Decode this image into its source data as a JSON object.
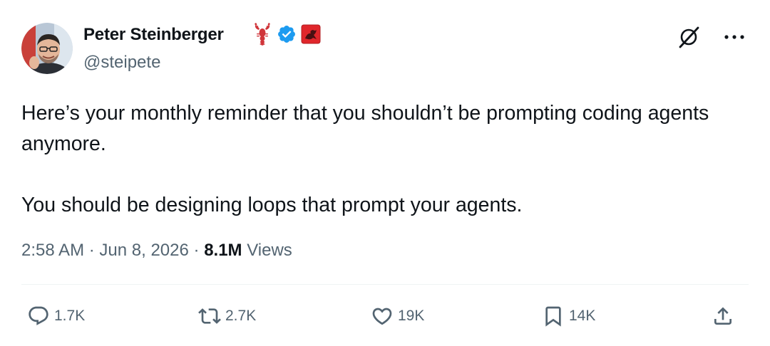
{
  "user": {
    "display_name": "Peter Steinberger",
    "handle": "@steipete",
    "name_icons": [
      "lobster-icon",
      "verified-badge-icon",
      "flag-badge-icon"
    ],
    "verified_color": "#1d9bf0"
  },
  "tweet": {
    "paragraphs": [
      "Here’s your monthly reminder that you shouldn’t be prompting coding agents anymore.",
      "You should be designing loops that prompt your agents."
    ],
    "time": "2:58 AM",
    "date": "Jun 8, 2026",
    "separator": "·",
    "views_count": "8.1M",
    "views_label": "Views"
  },
  "top_actions": [
    "grok-icon",
    "more-icon"
  ],
  "actions": {
    "replies": "1.7K",
    "reposts": "2.7K",
    "likes": "19K",
    "bookmarks": "14K"
  },
  "colors": {
    "text": "#0f1419",
    "secondary": "#536471",
    "divider": "#eff3f4",
    "accent": "#1d9bf0"
  }
}
